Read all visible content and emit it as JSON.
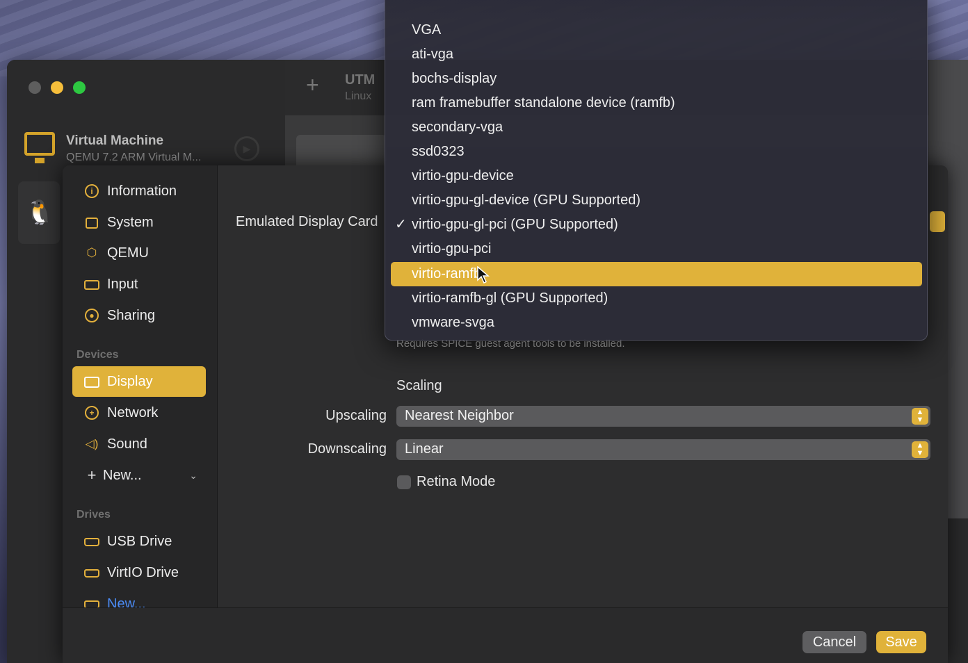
{
  "window": {
    "app_title": "UTM",
    "app_subtitle": "Linux",
    "vm_name": "Virtual Machine",
    "vm_subtitle": "QEMU 7.2 ARM Virtual M..."
  },
  "sidebar": {
    "items": [
      {
        "label": "Information",
        "icon": "info-icon"
      },
      {
        "label": "System",
        "icon": "cpu-icon"
      },
      {
        "label": "QEMU",
        "icon": "cube-icon"
      },
      {
        "label": "Input",
        "icon": "keyboard-icon"
      },
      {
        "label": "Sharing",
        "icon": "person-icon"
      }
    ],
    "devices_heading": "Devices",
    "devices": [
      {
        "label": "Display",
        "icon": "display-icon",
        "active": true
      },
      {
        "label": "Network",
        "icon": "globe-icon"
      },
      {
        "label": "Sound",
        "icon": "speaker-icon"
      },
      {
        "label": "New...",
        "icon": "plus-icon"
      }
    ],
    "drives_heading": "Drives",
    "drives": [
      {
        "label": "USB Drive",
        "icon": "drive-icon"
      },
      {
        "label": "VirtIO Drive",
        "icon": "drive-icon"
      },
      {
        "label": "New...",
        "icon": "drive-icon"
      }
    ]
  },
  "display": {
    "emulated_card_label": "Emulated Display Card",
    "hint": "Requires SPICE guest agent tools to be installed.",
    "scaling_title": "Scaling",
    "upscaling_label": "Upscaling",
    "upscaling_value": "Nearest Neighbor",
    "downscaling_label": "Downscaling",
    "downscaling_value": "Linear",
    "retina_label": "Retina Mode",
    "retina_checked": false
  },
  "dropdown": {
    "selected": "virtio-gpu-gl-pci (GPU Supported)",
    "highlighted": "virtio-ramfb",
    "options": [
      "VGA",
      "ati-vga",
      "bochs-display",
      "ram framebuffer standalone device (ramfb)",
      "secondary-vga",
      "ssd0323",
      "virtio-gpu-device",
      "virtio-gpu-gl-device (GPU Supported)",
      "virtio-gpu-gl-pci (GPU Supported)",
      "virtio-gpu-pci",
      "virtio-ramfb",
      "virtio-ramfb-gl (GPU Supported)",
      "vmware-svga"
    ]
  },
  "footer": {
    "cancel_label": "Cancel",
    "save_label": "Save"
  },
  "colors": {
    "accent": "#e0b23a",
    "background": "#2a2a2b"
  }
}
